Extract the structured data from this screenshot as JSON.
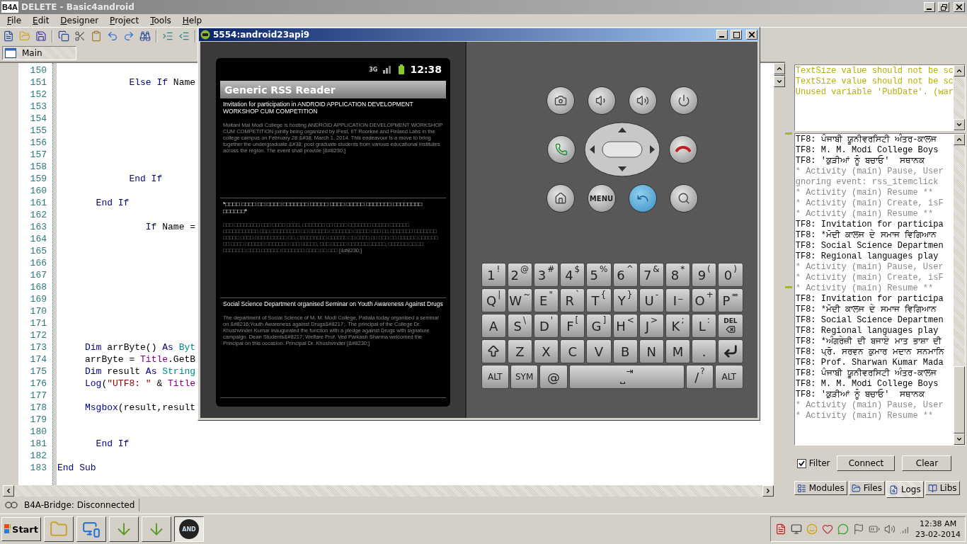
{
  "window": {
    "logo": "B4A",
    "title": "DELETE - Basic4android"
  },
  "menu": [
    "File",
    "Edit",
    "Designer",
    "Project",
    "Tools",
    "Help"
  ],
  "module_tabs": [
    {
      "label": "Main",
      "selected": true
    }
  ],
  "editor": {
    "lines": [
      {
        "number": "150"
      },
      {
        "number": "151",
        "tokens": [
          {
            "text": "             Else If",
            "kind": "keyword"
          },
          {
            "text": " Name",
            "kind": "plain"
          }
        ]
      },
      {
        "number": "152"
      },
      {
        "number": "153"
      },
      {
        "number": "154"
      },
      {
        "number": "155"
      },
      {
        "number": "156"
      },
      {
        "number": "157"
      },
      {
        "number": "158"
      },
      {
        "number": "159",
        "tokens": [
          {
            "text": "             End If",
            "kind": "keyword"
          }
        ]
      },
      {
        "number": "160"
      },
      {
        "number": "161",
        "tokens": [
          {
            "text": "       End If",
            "kind": "keyword"
          }
        ]
      },
      {
        "number": "162"
      },
      {
        "number": "163",
        "tokens": [
          {
            "text": "                If",
            "kind": "keyword"
          },
          {
            "text": " Name =",
            "kind": "plain"
          }
        ]
      },
      {
        "number": "164"
      },
      {
        "number": "165"
      },
      {
        "number": "166"
      },
      {
        "number": "167"
      },
      {
        "number": "168"
      },
      {
        "number": "169"
      },
      {
        "number": "170"
      },
      {
        "number": "171"
      },
      {
        "number": "172"
      },
      {
        "number": "173",
        "tokens": [
          {
            "text": "     Dim",
            "kind": "keyword"
          },
          {
            "text": " arrByte() ",
            "kind": "plain"
          },
          {
            "text": "As",
            "kind": "keyword"
          },
          {
            "text": " Byt",
            "kind": "type"
          }
        ]
      },
      {
        "number": "174",
        "tokens": [
          {
            "text": "     arrByte = ",
            "kind": "plain"
          },
          {
            "text": "Title",
            "kind": "member"
          },
          {
            "text": ".GetB",
            "kind": "plain"
          }
        ]
      },
      {
        "number": "175",
        "tokens": [
          {
            "text": "     Dim",
            "kind": "keyword"
          },
          {
            "text": " result ",
            "kind": "plain"
          },
          {
            "text": "As",
            "kind": "keyword"
          },
          {
            "text": " String",
            "kind": "type"
          }
        ]
      },
      {
        "number": "176",
        "tokens": [
          {
            "text": "     Log",
            "kind": "keyword"
          },
          {
            "text": "(",
            "kind": "plain"
          },
          {
            "text": "\"UTF8: \"",
            "kind": "string"
          },
          {
            "text": " & ",
            "kind": "plain"
          },
          {
            "text": "Title",
            "kind": "member"
          }
        ]
      },
      {
        "number": "177"
      },
      {
        "number": "178",
        "tokens": [
          {
            "text": "     Msgbox",
            "kind": "keyword"
          },
          {
            "text": "(result,result",
            "kind": "plain"
          }
        ]
      },
      {
        "number": "179"
      },
      {
        "number": "180"
      },
      {
        "number": "181",
        "tokens": [
          {
            "text": "       End If",
            "kind": "keyword"
          }
        ]
      },
      {
        "number": "182"
      },
      {
        "number": "183",
        "tokens": [
          {
            "text": "End Sub",
            "kind": "keyword"
          }
        ]
      }
    ]
  },
  "warnings": [
    "TextSize value should not be sc",
    "TextSize value should not be sc",
    "Unused variable 'PubDate'. (war"
  ],
  "logs": [
    {
      "text": "TF8: ਪੰਜਾਬੀ ਯੂਨੀਵਰਸਿਟੀ ਅੰਤਰ-ਕਾਲਜ",
      "kind": "output"
    },
    {
      "text": "TF8: M. M. Modi College Boys",
      "kind": "output"
    },
    {
      "text": "TF8: 'ਕੁੜੀਆਂ ਨੂੰ ਬਚਾਓ'  ਸਥਾਨਕ",
      "kind": "output"
    },
    {
      "text": "* Activity (main) Pause, User",
      "kind": "system"
    },
    {
      "text": "gnoring event: rss_itemclick",
      "kind": "system"
    },
    {
      "text": "* Activity (main) Resume **",
      "kind": "system"
    },
    {
      "text": "* Activity (main) Create, isF",
      "kind": "system"
    },
    {
      "text": "* Activity (main) Resume **",
      "kind": "system"
    },
    {
      "text": "TF8: Invitation for participa",
      "kind": "output"
    },
    {
      "text": "TF8: *ਮੋਦੀ ਕਾਲਜ ਦੇ ਸਮਾਜ ਵਿਗਿਆਨ",
      "kind": "output"
    },
    {
      "text": "TF8: Social Science Departmen",
      "kind": "output"
    },
    {
      "text": "TF8: Regional languages play",
      "kind": "output"
    },
    {
      "text": "* Activity (main) Pause, User",
      "kind": "system"
    },
    {
      "text": "* Activity (main) Create, isF",
      "kind": "system"
    },
    {
      "text": "* Activity (main) Resume **",
      "kind": "system"
    },
    {
      "text": "TF8: Invitation for participa",
      "kind": "output"
    },
    {
      "text": "TF8: *ਮੋਦੀ ਕਾਲਜ ਦੇ ਸਮਾਜ ਵਿਗਿਆਨ",
      "kind": "output"
    },
    {
      "text": "TF8: Social Science Departmen",
      "kind": "output"
    },
    {
      "text": "TF8: Regional languages play",
      "kind": "output"
    },
    {
      "text": "TF8: *ਅੰਗਰੇਜ਼ੀ ਦੀ ਬਜਾਏ ਮਾਤ ਭਾਸ਼ਾ ਦੀ",
      "kind": "output"
    },
    {
      "text": "TF8: ਪ੍ਰੋ. ਸਰਵਨ ਕੁਮਾਰ ਮਦਾਨ ਸਨਮਾਨਿ",
      "kind": "output"
    },
    {
      "text": "TF8: Prof. Sharwan Kumar Mada",
      "kind": "output"
    },
    {
      "text": "TF8: ਪੰਜਾਬੀ ਯੂਨੀਵਰਸਿਟੀ ਅੰਤਰ-ਕਾਲਜ",
      "kind": "output"
    },
    {
      "text": "TF8: M. M. Modi College Boys",
      "kind": "output"
    },
    {
      "text": "TF8: 'ਕੁੜੀਆਂ ਨੂੰ ਬਚਾਓ'  ਸਥਾਨਕ",
      "kind": "output"
    },
    {
      "text": "* Activity (main) Pause, User",
      "kind": "system"
    },
    {
      "text": "* Activity (main) Resume **",
      "kind": "system"
    }
  ],
  "filter": {
    "label": "Filter",
    "checked": true
  },
  "log_buttons": [
    "Connect",
    "Clear"
  ],
  "panel_tabs": [
    {
      "label": "Modules",
      "kind": "modules",
      "selected": false
    },
    {
      "label": "Files",
      "kind": "files",
      "selected": false
    },
    {
      "label": "Logs",
      "kind": "logs",
      "selected": true
    },
    {
      "label": "Libs",
      "kind": "libs",
      "selected": false
    }
  ],
  "status_bar": "B4A-Bridge: Disconnected",
  "emulator": {
    "title": "5554:android23api9",
    "network": "3G",
    "time": "12:38",
    "app_title": "Generic RSS Reader",
    "menu_key": "MENU",
    "feed": [
      {
        "title": "Invitation for participation in  ANDROID APPLICATION DEVELOPMENT WORKSHOP CUM COMPETITION",
        "description": "Multani Mal Modi College is hosting ANDROID APPLICATION DEVELOPMENT WORKSHOP CUM COMPETITION jointly being organized by iFest, IIT Roorkee and Finland Labs in the college campus on February 28 &#38; March 1, 2014. This endeavour is a move to bring together the undergraduate &#38; post graduate students from various educational institutes across the region. The event shall provide [&#8230;]"
      },
      {
        "title": "*□□□□ □□□□ □□ □□□□ □□□□□□□ □□□□□ □□□□ □□□□□ □□□□□□□ □□□□□□□□ □□□□□□*",
        "description": "□□□ □□□□□□□□ □□□ □□□□ □□□□, □□□□□□□ □□ □□□□ □□□□□□□ □□□□□ □□□□□□ □□□□□□□□□□□ □□□ □□□□□□□□□ □□ □□□□□□ □□□□□□□ □□□□□ □□□ □□ □□□□□□□ □□□□□□□ □□□□□ □□□□ □□□□□□□□□□ □□. □□□□□□□□□ □□□□□□ □□ □□□□ □□ □□□ □□ □□□□□□ □□□□□□ □□ □□□□ □□□□□□ □□□□□□□ □□□ □□□□□, □□□ □□□□□ □□□□□□ □□□□□, □□□□□□ □□ □□ □□□□□□□ □□□□ □□□□□□ □□□□□□□ □□□□ □□ □□□ [&#8230;]"
      },
      {
        "title": "Social Science Department organised Seminar on Youth Awareness Against Drugs",
        "description": "The department of Social Science of M. M. Modi College, Patiala today organised a seminar on &#8216;Youth Awareness against Drugs&#8217;.  The principal of the College Dr. Khushvinder Kumar inaugurated the function with a pledge against Drugs with signature campaign. Dean Students&#8217; Welfare Prof. Ved Parkash Sharma welcomed the Principal on this occasion. Principal Dr. Khushvinder [&#8230;]"
      }
    ],
    "keyboard": [
      [
        {
          "main": "1",
          "alt": "!",
          "kind": "char"
        },
        {
          "main": "2",
          "alt": "@",
          "kind": "char"
        },
        {
          "main": "3",
          "alt": "#",
          "kind": "char"
        },
        {
          "main": "4",
          "alt": "$",
          "kind": "char"
        },
        {
          "main": "5",
          "alt": "%",
          "kind": "char"
        },
        {
          "main": "6",
          "alt": "^",
          "kind": "char"
        },
        {
          "main": "7",
          "alt": "&",
          "kind": "char"
        },
        {
          "main": "8",
          "alt": "*",
          "kind": "char"
        },
        {
          "main": "9",
          "alt": "(",
          "kind": "char"
        },
        {
          "main": "0",
          "alt": ")",
          "kind": "char"
        }
      ],
      [
        {
          "main": "Q",
          "alt": "|",
          "kind": "char"
        },
        {
          "main": "W",
          "alt": "~",
          "kind": "char"
        },
        {
          "main": "E",
          "alt": "\"",
          "kind": "char"
        },
        {
          "main": "R",
          "alt": "`",
          "kind": "char"
        },
        {
          "main": "T",
          "alt": "{",
          "kind": "char"
        },
        {
          "main": "Y",
          "alt": "}",
          "kind": "char"
        },
        {
          "main": "U",
          "alt": "-",
          "kind": "char"
        },
        {
          "main": "I",
          "alt": "_",
          "kind": "char"
        },
        {
          "main": "O",
          "alt": "+",
          "kind": "char"
        },
        {
          "main": "P",
          "alt": "=",
          "kind": "char"
        }
      ],
      [
        {
          "main": "A",
          "kind": "char"
        },
        {
          "main": "S",
          "alt": "\\",
          "kind": "char"
        },
        {
          "main": "D",
          "alt": "'",
          "kind": "char"
        },
        {
          "main": "F",
          "alt": "[",
          "kind": "char"
        },
        {
          "main": "G",
          "alt": "]",
          "kind": "char"
        },
        {
          "main": "H",
          "alt": "<",
          "kind": "char"
        },
        {
          "main": "J",
          "alt": ">",
          "kind": "char"
        },
        {
          "main": "K",
          "alt": ";",
          "kind": "char"
        },
        {
          "main": "L",
          "alt": ":",
          "kind": "char"
        },
        {
          "main": "DEL",
          "kind": "del"
        }
      ],
      [
        {
          "kind": "shift"
        },
        {
          "main": "Z",
          "kind": "char"
        },
        {
          "main": "X",
          "kind": "char"
        },
        {
          "main": "C",
          "kind": "char"
        },
        {
          "main": "V",
          "kind": "char"
        },
        {
          "main": "B",
          "kind": "char"
        },
        {
          "main": "N",
          "kind": "char"
        },
        {
          "main": "M",
          "kind": "char"
        },
        {
          "main": ".",
          "kind": "char"
        },
        {
          "kind": "enter"
        }
      ],
      [
        {
          "main": "ALT",
          "kind": "char"
        },
        {
          "main": "SYM",
          "kind": "char"
        },
        {
          "main": "@",
          "kind": "char"
        },
        {
          "main": "⎵",
          "alt": "⇥",
          "kind": "space"
        },
        {
          "main": "/",
          "alt": "?",
          "kind": "char"
        },
        {
          "main": "ALT",
          "kind": "char"
        }
      ]
    ]
  },
  "taskbar": {
    "start": "Start",
    "apps": [
      {
        "kind": "folder",
        "selected": false
      },
      {
        "kind": "remote",
        "selected": false
      },
      {
        "kind": "download",
        "selected": false
      },
      {
        "kind": "download",
        "selected": false
      },
      {
        "kind": "emulator",
        "label": "AND",
        "selected": true
      }
    ],
    "time": "12:38 AM",
    "date": "23-02-2014"
  }
}
